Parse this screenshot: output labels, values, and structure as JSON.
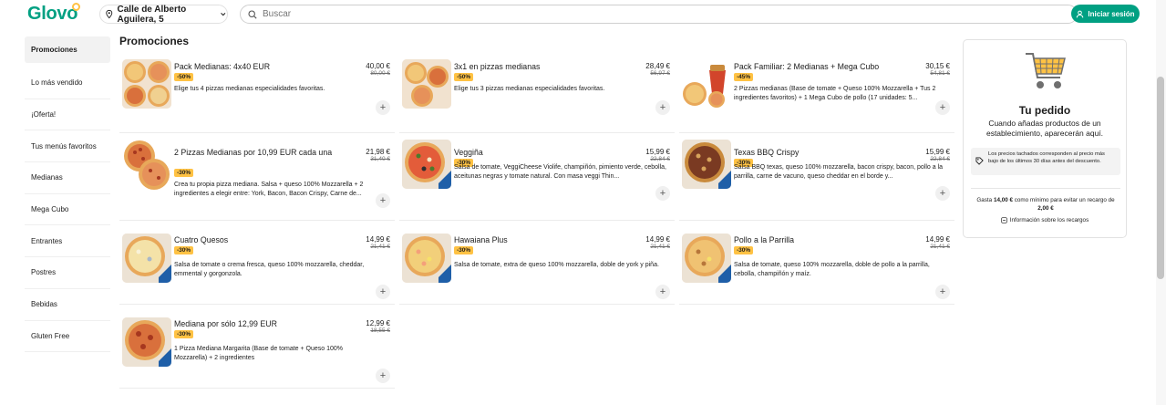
{
  "header": {
    "logo": "Glovo",
    "address": "Calle de Alberto Aguilera, 5",
    "search_placeholder": "Buscar",
    "login_label": "Iniciar sesión"
  },
  "colors": {
    "brand": "#00a082",
    "badge": "#ffc244"
  },
  "sidebar": {
    "items": [
      {
        "label": "Promociones",
        "active": true
      },
      {
        "label": "Lo más vendido"
      },
      {
        "label": "¡Oferta!"
      },
      {
        "label": "Tus menús favoritos"
      },
      {
        "label": "Medianas"
      },
      {
        "label": "Mega Cubo"
      },
      {
        "label": "Entrantes"
      },
      {
        "label": "Postres"
      },
      {
        "label": "Bebidas"
      },
      {
        "label": "Gluten Free"
      }
    ]
  },
  "section_title": "Promociones",
  "products": [
    {
      "title": "Pack Medianas: 4x40 EUR",
      "price": "40,00 €",
      "old_price": "80,00 €",
      "discount": "-50%",
      "desc": "Elige tus 4 pizzas medianas especialidades favoritas.",
      "add": "+"
    },
    {
      "title": "3x1 en pizzas medianas",
      "price": "28,49 €",
      "old_price": "56,97 €",
      "discount": "-50%",
      "desc": "Elige tus 3 pizzas medianas especialidades favoritas.",
      "add": "+"
    },
    {
      "title": "Pack Familiar: 2 Medianas + Mega Cubo",
      "price": "30,15 €",
      "old_price": "54,81 €",
      "discount": "-45%",
      "desc": "2 Pizzas medianas (Base de tomate + Queso 100% Mozzarella + Tus 2 ingredientes favoritos) + 1 Mega Cubo de pollo (17 unidades: 5...",
      "add": "+"
    },
    {
      "title": "2 Pizzas Medianas por 10,99 EUR cada una",
      "price": "21,98 €",
      "old_price": "31,40 €",
      "discount": "-30%",
      "desc": "Crea tu propia pizza mediana. Salsa + queso 100% Mozzarella + 2 ingredientes a elegir entre: York, Bacon, Bacon Crispy, Carne de...",
      "add": "+"
    },
    {
      "title": "Veggiña",
      "price": "15,99 €",
      "old_price": "22,84 €",
      "discount": "-30%",
      "desc": "Salsa de tomate, VeggiCheese Violife, champiñón, pimiento verde, cebolla, aceitunas negras y tomate natural. Con masa veggi Thin...",
      "add": "+"
    },
    {
      "title": "Texas BBQ Crispy",
      "price": "15,99 €",
      "old_price": "22,84 €",
      "discount": "-30%",
      "desc": "Salsa BBQ texas, queso 100% mozzarella, bacon crispy, bacon, pollo a la parrilla, carne de vacuno, queso cheddar en el borde y...",
      "add": "+"
    },
    {
      "title": "Cuatro Quesos",
      "price": "14,99 €",
      "old_price": "21,41 €",
      "discount": "-30%",
      "desc": "Salsa de tomate o crema fresca, queso 100% mozzarella, cheddar, emmental y gorgonzola.",
      "add": "+"
    },
    {
      "title": "Hawaiana Plus",
      "price": "14,99 €",
      "old_price": "21,41 €",
      "discount": "-30%",
      "desc": "Salsa de tomate, extra de queso 100% mozzarella, doble de york y piña.",
      "add": "+"
    },
    {
      "title": "Pollo a la Parrilla",
      "price": "14,99 €",
      "old_price": "21,41 €",
      "discount": "-30%",
      "desc": "Salsa de tomate, queso 100% mozzarella, doble de pollo a la parrilla, cebolla, champiñón y maíz.",
      "add": "+"
    },
    {
      "title": "Mediana por sólo 12,99 EUR",
      "price": "12,99 €",
      "old_price": "18,55 €",
      "discount": "-30%",
      "desc": "1 Pizza Mediana Margarita (Base de tomate + Queso 100% Mozzarella) + 2 ingredientes",
      "add": "+"
    }
  ],
  "order": {
    "title": "Tu pedido",
    "subtitle": "Cuando añadas productos de un establecimiento, aparecerán aquí.",
    "note": "Los precios tachados corresponden al precio más bajo de los últimos 30 días antes del descuento.",
    "min_pre": "Gasta ",
    "min_amount": "14,00 €",
    "min_mid": " como mínimo para evitar un recargo de ",
    "min_fee": "2,00 €",
    "link": "Información sobre los recargos"
  }
}
